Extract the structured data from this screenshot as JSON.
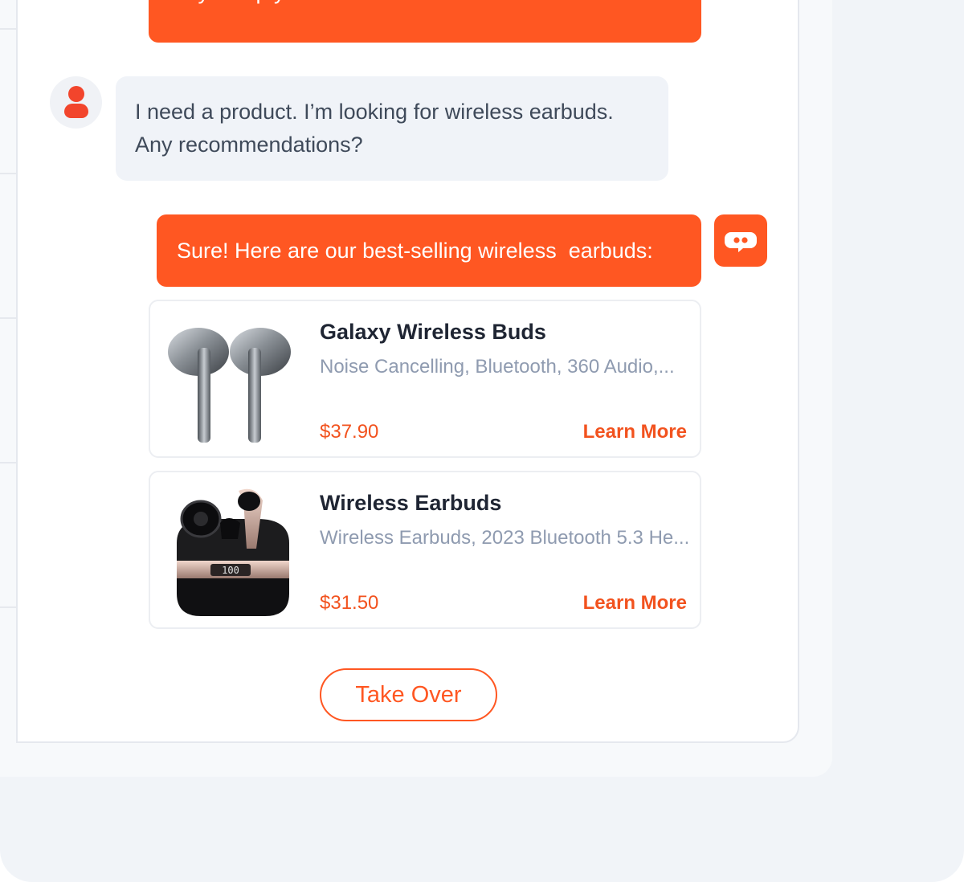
{
  "chat": {
    "messages": [
      {
        "role": "bot",
        "text": "may I help you?"
      },
      {
        "role": "user",
        "line1": "I need a product. I’m looking for wireless earbuds.",
        "line2": "Any recommendations?"
      },
      {
        "role": "bot",
        "text": "Sure! Here are our best-selling wireless  earbuds:"
      }
    ],
    "products": [
      {
        "name": "Galaxy Wireless Buds",
        "description": "Noise Cancelling, Bluetooth, 360 Audio,...",
        "price": "$37.90",
        "action": "Learn More"
      },
      {
        "name": "Wireless Earbuds",
        "description": "Wireless Earbuds, 2023 Bluetooth 5.3 He...",
        "price": "$31.50",
        "action": "Learn More",
        "case_display": "100"
      }
    ],
    "take_over_label": "Take Over"
  },
  "colors": {
    "accent": "#ff5722",
    "price": "#f2521e",
    "user_bubble": "#f0f3f8",
    "muted_text": "#8f9bb0"
  },
  "icons": {
    "user_avatar": "user-icon",
    "bot_avatar": "chat-bot-icon"
  }
}
